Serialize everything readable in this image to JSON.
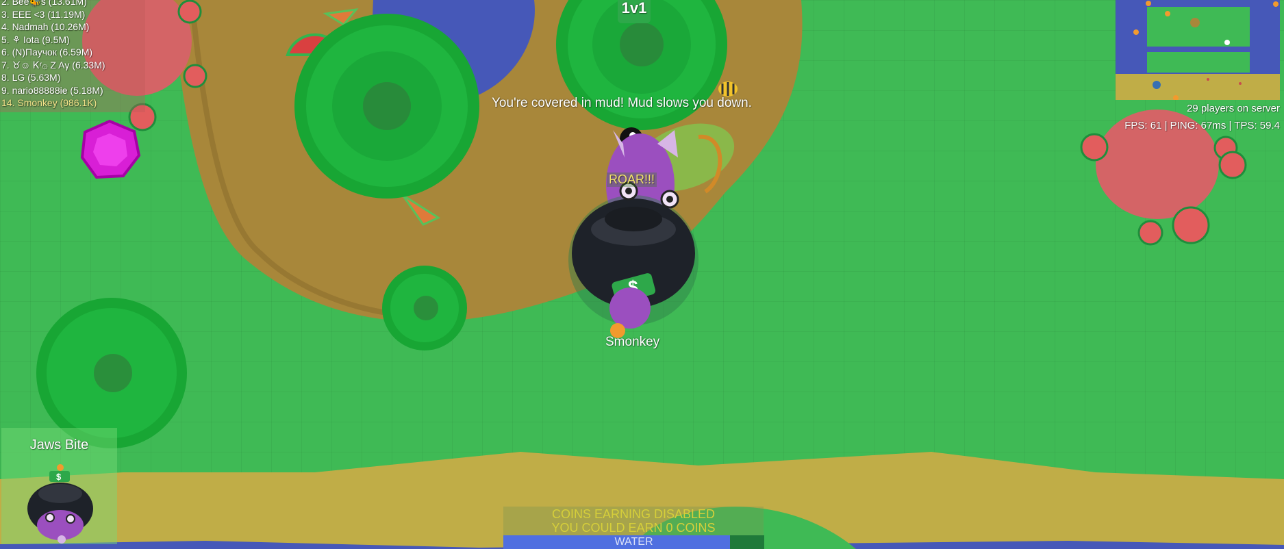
{
  "game": {
    "leaderboard": [
      {
        "text": "2. Bee🐝s (13.61M)",
        "me": false
      },
      {
        "text": "3. EEE <3 (11.19M)",
        "me": false
      },
      {
        "text": "4. Nadmah (10.26M)",
        "me": false
      },
      {
        "text": "5. ⚘ Iota (9.5M)",
        "me": false
      },
      {
        "text": "6. (N)Паучок (6.59M)",
        "me": false
      },
      {
        "text": "7. ♉☺ Ꮶʳ۞ Z Aγ (6.33M)",
        "me": false
      },
      {
        "text": "8. LG (5.63M)",
        "me": false
      },
      {
        "text": "9. nario88888ie (5.18M)",
        "me": false
      },
      {
        "text": "14. Smonkey (986.1K)",
        "me": true
      }
    ],
    "players_on_server": "29 players on server",
    "perf_stats": "FPS: 61 | PING: 67ms | TPS: 59.4",
    "status_message": "You're covered in mud! Mud slows you down.",
    "mode_badge": "1v1",
    "shout": "ROAR!!!",
    "player_name": "Smonkey",
    "ability_name": "Jaws Bite",
    "coins_line1": "COINS EARNING DISABLED",
    "coins_line2": "YOU COULD EARN 0 COINS",
    "water_label": "WATER",
    "water_level": 0.87,
    "colors": {
      "grass": "#3fba55",
      "mud": "#a8873a",
      "sand": "#c0ad47",
      "water": "#4658b8",
      "tree": "#15a635",
      "berry_bush": "#d46466",
      "player_body": "#9b4fbf",
      "water_bar": "#4f6fe0"
    }
  }
}
